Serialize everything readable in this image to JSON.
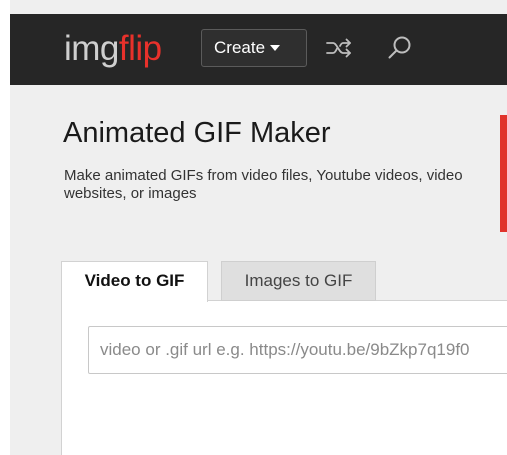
{
  "header": {
    "logo_main": "img",
    "logo_accent": "flip",
    "create_label": "Create",
    "icons": [
      "shuffle-icon",
      "search-icon"
    ],
    "brand_color": "#e8312b"
  },
  "main": {
    "title": "Animated GIF Maker",
    "subtitle": "Make animated GIFs from video files, Youtube videos, video websites, or images"
  },
  "tabs": [
    {
      "label": "Video to GIF",
      "active": true
    },
    {
      "label": "Images to GIF",
      "active": false
    }
  ],
  "url_input": {
    "value": "",
    "placeholder": "video or .gif url e.g. https://youtu.be/9bZkp7q19f0"
  }
}
